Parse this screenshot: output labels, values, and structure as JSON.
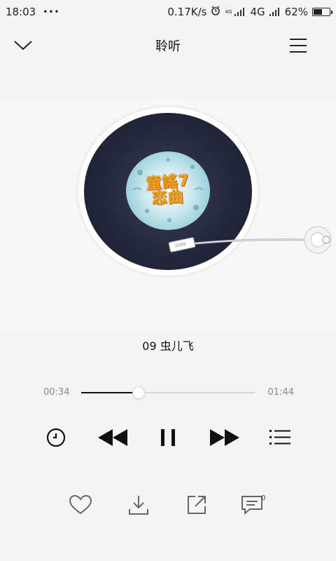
{
  "status_bar": {
    "time": "18:03",
    "dots": "•••",
    "speed": "0.17K/s",
    "network_small": "4G",
    "network": "4G",
    "battery": "62%",
    "battery_level": 0.62
  },
  "header": {
    "title": "聆听"
  },
  "album": {
    "art_text": "童謠7\n恋曲"
  },
  "song": {
    "title": "09 虫儿飞"
  },
  "progress": {
    "current": "00:34",
    "total": "01:44",
    "fraction": 0.33
  },
  "actions": {
    "comment_count": "0"
  },
  "colors": {
    "background": "#f4f4f4",
    "disc": "#23263b",
    "accent_orange": "#f0a21f"
  }
}
